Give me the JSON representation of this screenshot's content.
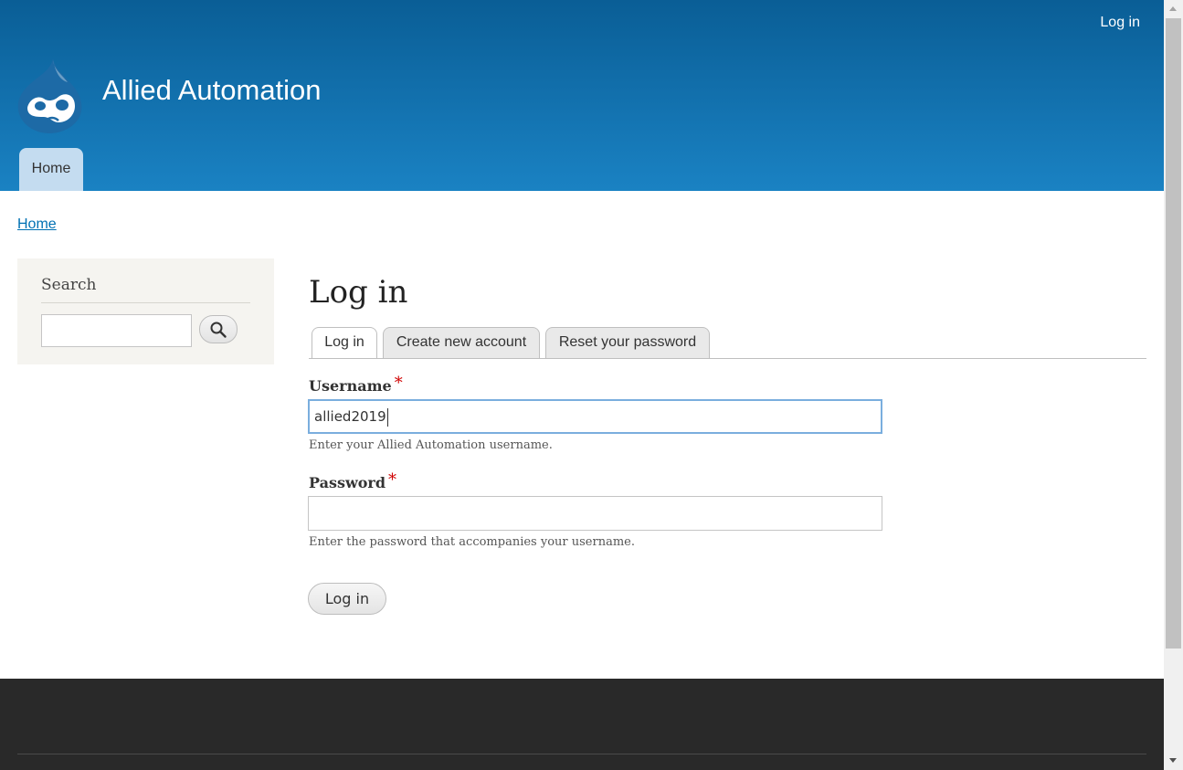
{
  "header": {
    "user_menu": {
      "login_label": "Log in"
    },
    "site_name": "Allied Automation",
    "logo_icon": "drupal-drop-icon",
    "nav": [
      {
        "label": "Home",
        "active": true
      }
    ]
  },
  "breadcrumb": {
    "items": [
      "Home"
    ]
  },
  "sidebar": {
    "search": {
      "title": "Search",
      "value": "",
      "button_icon": "search-icon"
    }
  },
  "main": {
    "title": "Log in",
    "tabs": [
      {
        "label": "Log in",
        "active": true
      },
      {
        "label": "Create new account",
        "active": false
      },
      {
        "label": "Reset your password",
        "active": false
      }
    ],
    "form": {
      "username": {
        "label": "Username",
        "required_mark": "*",
        "value": "allied2019",
        "description": "Enter your Allied Automation username."
      },
      "password": {
        "label": "Password",
        "required_mark": "*",
        "value": "",
        "description": "Enter the password that accompanies your username."
      },
      "submit_label": "Log in"
    }
  },
  "colors": {
    "header_top": "#0a5e96",
    "header_bottom": "#1a82c3",
    "link": "#0071b3",
    "required": "#d00000",
    "footer": "#292929"
  }
}
